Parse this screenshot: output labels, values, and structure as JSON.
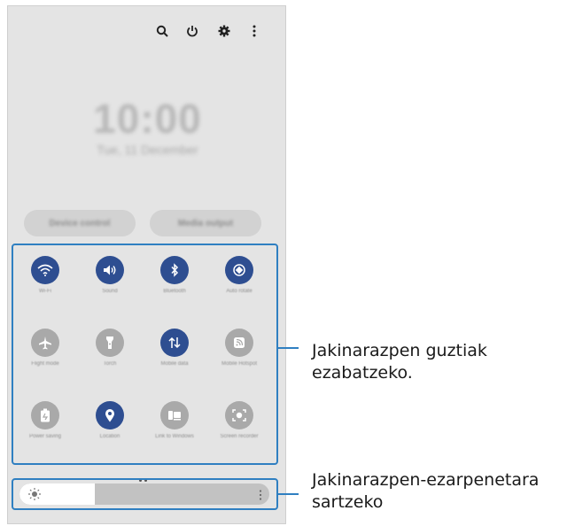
{
  "header": {
    "icons": [
      "search-icon",
      "power-icon",
      "settings-gear-icon",
      "more-options-icon"
    ]
  },
  "clock": {
    "time": "10:00",
    "date": "Tue, 11 December"
  },
  "buttons": {
    "device_control": "Device control",
    "media_output": "Media output"
  },
  "tiles": [
    {
      "label": "Wi-Fi",
      "icon": "wifi-icon",
      "on": true
    },
    {
      "label": "Sound",
      "icon": "sound-icon",
      "on": true
    },
    {
      "label": "Bluetooth",
      "icon": "bluetooth-icon",
      "on": true
    },
    {
      "label": "Auto rotate",
      "icon": "auto-rotate-icon",
      "on": true
    },
    {
      "label": "Flight mode",
      "icon": "airplane-icon",
      "on": false
    },
    {
      "label": "Torch",
      "icon": "torch-icon",
      "on": false
    },
    {
      "label": "Mobile data",
      "icon": "mobile-data-icon",
      "on": true
    },
    {
      "label": "Mobile Hotspot",
      "icon": "hotspot-icon",
      "on": false
    },
    {
      "label": "Power saving",
      "icon": "power-saving-icon",
      "on": false
    },
    {
      "label": "Location",
      "icon": "location-icon",
      "on": true
    },
    {
      "label": "Link to Windows",
      "icon": "link-windows-icon",
      "on": false
    },
    {
      "label": "Screen recorder",
      "icon": "screen-recorder-icon",
      "on": false
    }
  ],
  "brightness": {
    "level": 0.3
  },
  "callouts": {
    "top_line1": "Jakinarazpen guztiak",
    "top_line2": "ezabatzeko.",
    "bottom_line1": "Jakinarazpen-ezarpenetara",
    "bottom_line2": "sartzeko"
  },
  "colors": {
    "accent": "#2e4e91",
    "callout": "#2f7fc1"
  }
}
